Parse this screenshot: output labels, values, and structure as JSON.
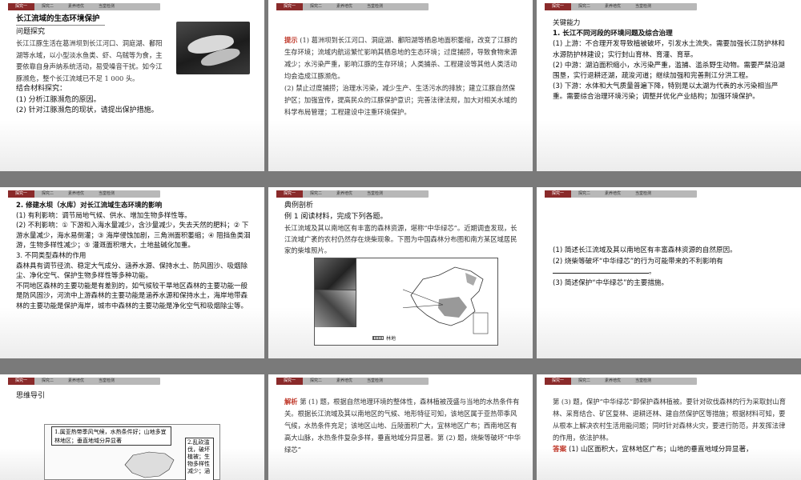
{
  "tabs": [
    "探究一",
    "探究二",
    "素养培优",
    "当堂检测"
  ],
  "slide1": {
    "title": "长江流域的生态环境保护",
    "section": "问题探究",
    "passage": "长江江豚生活在葛洲坝到长江河口、洞庭湖、鄱阳湖等水域，以小型淡水鱼类、虾、乌贼等为食，主要依靠自身声纳系统活动，易受噪音干扰。如今江豚濒危，整个长江流域已不足 1 000 头。",
    "sub": "结合材料探究：",
    "q1": "(1) 分析江豚濒危的原因。",
    "q2": "(2) 针对江豚濒危的现状，请提出保护措施。"
  },
  "slide2": {
    "tip_label": "提示",
    "p1": "(1) 葛洲坝到长江河口、洞庭湖、鄱阳湖等栖息地面积萎缩，改变了江豚的生存环境；流域内航运繁忙影响其栖息地的生态环境；过度捕捞，导致食物来源减少；水污染严重，影响江豚的生存环境；人类捕杀、工程建设等其他人类活动均会造成江豚濒危。",
    "p2": "(2) 禁止过度捕捞；治理水污染，减少生产、生活污水的排放；建立江豚自然保护区；加强宣传，提高民众的江豚保护意识；完善法律法规，加大对相关水域的科学布局管理；工程建设中注重环境保护。"
  },
  "slide3": {
    "heading": "关键能力",
    "sub": "1. 长江不同河段的环境问题及综合治理",
    "p1": "(1) 上游：不合理开发导致植被破坏，引发水土流失。需要加强长江防护林和水源防护林建设；实行封山育林、育灌、育草。",
    "p2": "(2) 中游：湖泊面积缩小，水污染严重，滥捕、滥杀野生动物。需要严禁沿湖围垦，实行退耕还湖，疏浚河道；继续加强和完善荆江分洪工程。",
    "p3": "(3) 下游：水体和大气质量普遍下降，特别是以太湖为代表的水污染相当严重。需要综合治理环境污染；调整并优化产业结构；加强环境保护。"
  },
  "slide4": {
    "heading": "2. 修建水坝（水库）对长江流域生态环境的影响",
    "p1": "(1) 有利影响：调节局地气候、供水、增加生物多样性等。",
    "p2": "(2) 不利影响：① 下游和入海水量减少，含沙量减少，失去天然的肥料；② 下游水量减少，海水易倒灌；③ 海岸侵蚀加剧，三角洲面积萎缩；④ 阻挡鱼类洄游，生物多样性减少；⑤ 灌溉面积增大，土地盐碱化加重。",
    "heading2": "3. 不同类型森林的作用",
    "p3": "森林具有调节径流、稳定大气成分、涵养水源、保持水土、防风固沙、吸烟除尘、净化空气、保护生物多样性等多种功能。",
    "p4": "不同地区森林的主要功能是有差别的，如气候较干旱地区森林的主要功能一般是防风固沙，河流中上游森林的主要功能是涵养水源和保持水土，海岸地带森林的主要功能是保护海岸，城市中森林的主要功能是净化空气和吸烟除尘等。"
  },
  "slide5": {
    "heading": "典例剖析",
    "sub": "例 1  阅读材料，完成下列各题。",
    "passage": "长江流域及其以南地区有丰富的森林资源，堪称“中华绿芯”。近期调查发现，长江流域广袤的农村仍然存在烧柴现象。下图为中国森林分布图和南方某区域居民家的柴堆照片。",
    "legend": "林地"
  },
  "slide6": {
    "q1": "(1) 简述长江流域及其以南地区有丰富森林资源的自然原因。",
    "q2": "(2) 烧柴等破坏“中华绿芯”的行为可能带来的不利影响有",
    "q2_end": "。",
    "q3": "(3) 简述保护“中华绿芯”的主要措施。"
  },
  "slide7": {
    "heading": "思维导引",
    "box1": "1.属亚热带季风气候，水热条件好；山地多宜林地区；垂直地域分异显著",
    "box2": "2.乱砍滥伐，破坏植被；生物多样性减少；涵"
  },
  "slide8": {
    "label": "解析",
    "text": "第 (1) 题，根据自然地理环境的整体性，森林植被茂盛与当地的水热条件有关。根据长江流域及其以南地区的气候、地形特征可知，该地区属于亚热带季风气候，水热条件充足；该地区山地、丘陵面积广大，宜林地区广布；西南地区有高大山脉，水热条件复杂多样，垂直地域分异显著。第 (2) 题，烧柴等破坏“中华绿芯”"
  },
  "slide9": {
    "text": "第 (3) 题，保护“中华绿芯”即保护森林植被。要针对砍伐森林的行为采取封山育林、采育结合、矿区复林、退耕还林、建自然保护区等措施；根据材料可知，要从根本上解决农村生活用能问题；同时针对森林火灾，要进行防范，并发挥法律的作用，依法护林。",
    "answer_label": "答案",
    "answer": "(1) 山区面积大，宜林地区广布；山地的垂直地域分异显著，"
  }
}
